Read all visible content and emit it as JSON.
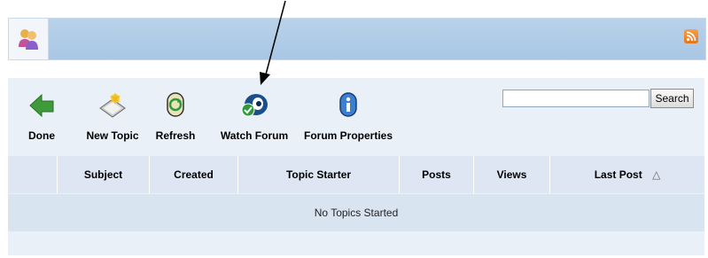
{
  "toolbar": {
    "done_label": "Done",
    "new_topic_label": "New Topic",
    "refresh_label": "Refresh",
    "watch_forum_label": "Watch Forum",
    "forum_properties_label": "Forum Properties",
    "search_button_label": "Search",
    "search_value": ""
  },
  "table": {
    "columns": [
      "",
      "Subject",
      "Created",
      "Topic Starter",
      "Posts",
      "Views",
      "Last Post"
    ],
    "sort_indicator": "△",
    "empty_message": "No Topics Started"
  },
  "icons": {
    "header": "users-group-icon",
    "rss": "rss-feed-icon",
    "done": "back-arrow-icon",
    "new_topic": "new-document-icon",
    "refresh": "refresh-icon",
    "watch_forum": "watch-eye-icon",
    "forum_properties": "info-icon"
  },
  "colors": {
    "header_bar": "#a9c6e4",
    "panel_bg": "#eaf0f8",
    "table_header_bg": "#dde6f2",
    "rss_orange": "#e6731a"
  }
}
